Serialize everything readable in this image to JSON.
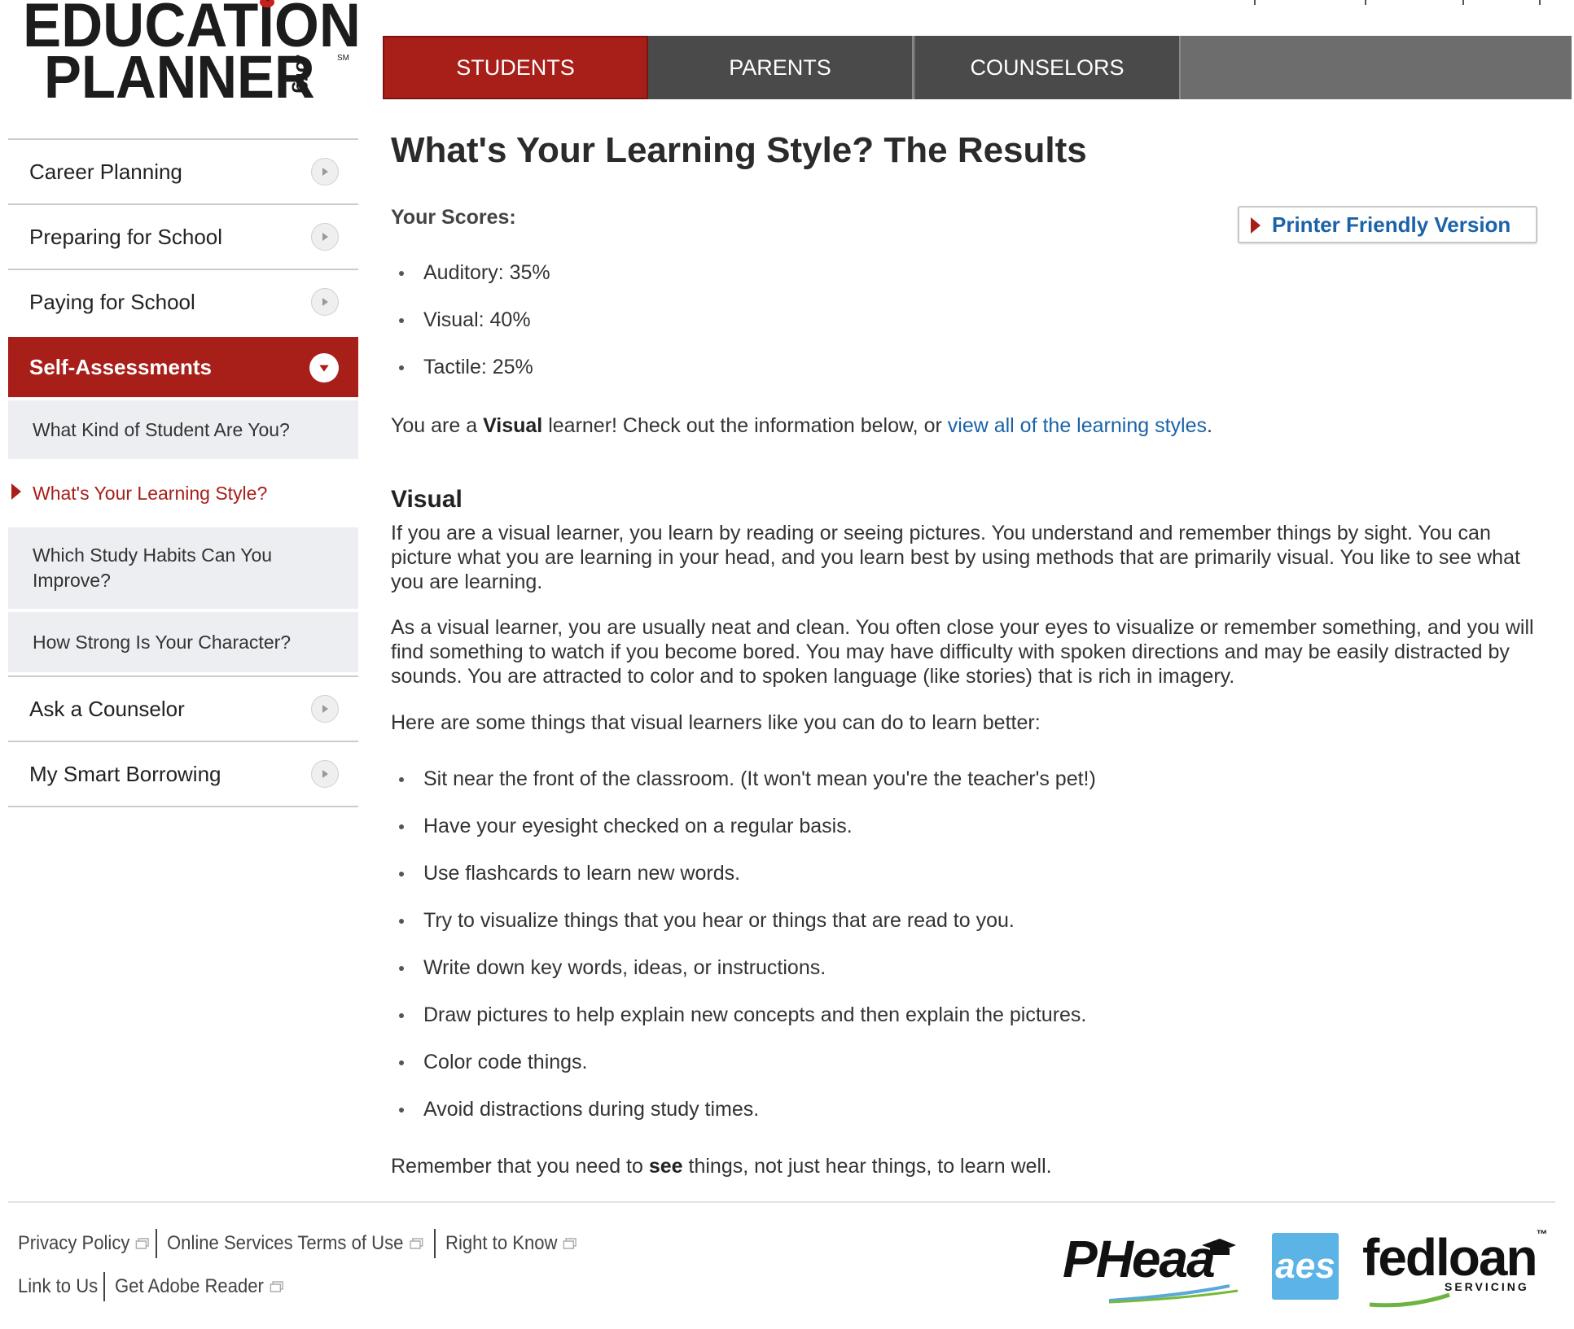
{
  "logo": {
    "line1": "EDUCATION",
    "line2": "PLANNER",
    "org": ".org",
    "sm": "SM"
  },
  "topnav": {
    "tabs": [
      {
        "label": "STUDENTS",
        "active": true
      },
      {
        "label": "PARENTS",
        "active": false
      },
      {
        "label": "COUNSELORS",
        "active": false
      }
    ]
  },
  "sidebar": {
    "items": [
      {
        "label": "Career Planning"
      },
      {
        "label": "Preparing for School"
      },
      {
        "label": "Paying for School"
      },
      {
        "label": "Self-Assessments"
      }
    ],
    "subitems": [
      {
        "label": "What Kind of Student Are You?"
      },
      {
        "label": "What's Your Learning Style?"
      },
      {
        "label": "Which Study Habits Can You Improve?"
      },
      {
        "label": "How Strong Is Your Character?"
      }
    ],
    "bottom_items": [
      {
        "label": "Ask a Counselor"
      },
      {
        "label": "My Smart Borrowing"
      }
    ]
  },
  "main": {
    "title": "What's Your Learning Style? The Results",
    "scores_label": "Your Scores:",
    "printer_button": "Printer Friendly Version",
    "scores": [
      "Auditory: 35%",
      "Visual: 40%",
      "Tactile: 25%"
    ],
    "result": {
      "prefix": "You are a ",
      "style": "Visual",
      "middle": " learner! Check out the information below, or ",
      "link": "view all of the learning styles",
      "suffix": "."
    },
    "section_title": "Visual",
    "para1": "If you are a visual learner, you learn by reading or seeing pictures. You understand and remember things by sight. You can picture what you are learning in your head, and you learn best by using methods that are primarily visual. You like to see what you are learning.",
    "para2": "As a visual learner, you are usually neat and clean. You often close your eyes to visualize or remember something, and you will find something to watch if you become bored. You may have difficulty with spoken directions and may be easily distracted by sounds. You are attracted to color and to spoken language (like stories) that is rich in imagery.",
    "tips_intro": "Here are some things that visual learners like you can do to learn better:",
    "tips": [
      "Sit near the front of the classroom. (It won't mean you're the teacher's pet!)",
      "Have your eyesight checked on a regular basis.",
      "Use flashcards to learn new words.",
      "Try to visualize things that you hear or things that are read to you.",
      "Write down key words, ideas, or instructions.",
      "Draw pictures to help explain new concepts and then explain the pictures.",
      "Color code things.",
      "Avoid distractions during study times."
    ],
    "closing": {
      "prefix": "Remember that you need to ",
      "emph": "see",
      "suffix": " things, not just hear things, to learn well."
    }
  },
  "footer": {
    "row1": [
      "Privacy Policy",
      "Online Services Terms of Use",
      "Right to Know"
    ],
    "row2": [
      "Link to Us",
      "Get Adobe Reader"
    ],
    "brands": {
      "pheaa": "PHeaa",
      "aes": "aes",
      "fedloan": "fedloan",
      "fedloan_sub": "SERVICING",
      "tm": "™"
    }
  },
  "colors": {
    "accent_red": "#a81f1a",
    "nav_dark": "#4a4a4a",
    "link_blue": "#1b62a8",
    "sub_bg": "#edeef2"
  }
}
